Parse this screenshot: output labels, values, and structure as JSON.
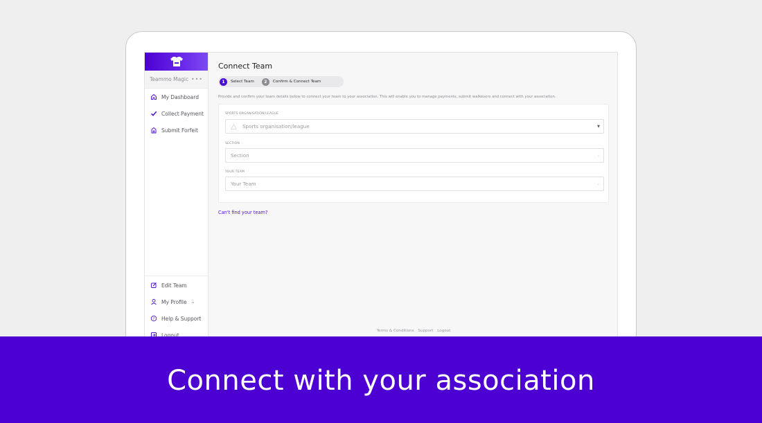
{
  "sidebar": {
    "team_name": "Teammo Magic",
    "team_menu": "•••",
    "items": [
      {
        "label": "My Dashboard",
        "icon": "home-icon"
      },
      {
        "label": "Collect Payment",
        "icon": "check-icon"
      },
      {
        "label": "Submit Forfeit",
        "icon": "forfeit-icon"
      }
    ],
    "bottom_items": [
      {
        "label": "Edit Team",
        "icon": "edit-icon"
      },
      {
        "label": "My Profile",
        "icon": "user-icon"
      },
      {
        "label": "Help & Support",
        "icon": "help-icon"
      },
      {
        "label": "Logout",
        "icon": "logout-icon"
      }
    ]
  },
  "main": {
    "title": "Connect Team",
    "steps": [
      {
        "num": "1",
        "label": "Select Team"
      },
      {
        "num": "2",
        "label": "Confirm & Connect Team"
      }
    ],
    "description": "Provide and confirm your team details below to connect your team to your association. This will enable you to manage payments, submit walkovers and connect with your association.",
    "fields": [
      {
        "label": "SPORTS ORGANISATION/LEAGUE",
        "placeholder": "Sports organisation/league"
      },
      {
        "label": "SECTION",
        "placeholder": "Section"
      },
      {
        "label": "YOUR TEAM",
        "placeholder": "Your Team"
      }
    ],
    "cant_find": "Can't find your team?",
    "footer": [
      "Terms & Conditions",
      "Support",
      "Logout"
    ]
  },
  "banner": {
    "text": "Connect with your association"
  },
  "colors": {
    "brand": "#4c00d1",
    "accent": "#4a0fcf"
  }
}
